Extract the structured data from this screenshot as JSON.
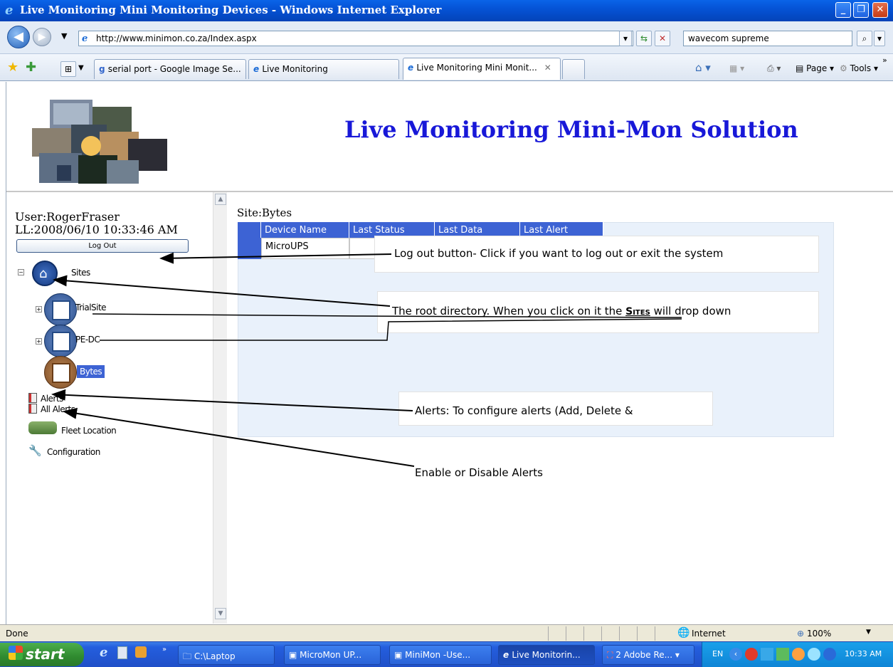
{
  "window": {
    "title": "Live Monitoring Mini Monitoring Devices - Windows Internet Explorer"
  },
  "browser": {
    "url": "http://www.minimon.co.za/Index.aspx",
    "search_value": "wavecom supreme",
    "tabs": [
      {
        "label": "serial port - Google Image Se..."
      },
      {
        "label": "Live Monitoring"
      },
      {
        "label": "Live Monitoring Mini Monit..."
      }
    ],
    "page_menu": "Page",
    "tools_menu": "Tools"
  },
  "header": {
    "title": "Live Monitoring Mini-Mon Solution"
  },
  "sidebar": {
    "user": "User:RogerFraser",
    "last_login": "LL:2008/06/10 10:33:46 AM",
    "logout_label": "Log Out",
    "tree": {
      "root": "Sites",
      "sites": [
        "TrialSite",
        "PE-DC",
        "Bytes"
      ]
    },
    "menu": [
      "Alerts",
      "All Alerts",
      "Fleet Location",
      "Configuration"
    ]
  },
  "main": {
    "site_label": "Site:Bytes",
    "columns": [
      "Device Name",
      "Last Status",
      "Last Data",
      "Last Alert"
    ],
    "rows": [
      [
        "MicroUPS"
      ]
    ]
  },
  "annotations": {
    "logout": "Log out button- Click if you want to log out or exit the system",
    "root_pre": "The root directory. When you click on it the ",
    "root_bold": "Sites",
    "root_post": " will drop down",
    "alerts": "Alerts: To configure alerts (Add, Delete &",
    "all_alerts": "Enable or Disable Alerts"
  },
  "statusbar": {
    "left": "Done",
    "zone": "Internet",
    "zoom": "100%"
  },
  "taskbar": {
    "start": "start",
    "items": [
      "C:\\Laptop",
      "MicroMon UP...",
      "MiniMon -Use...",
      "Live Monitorin...",
      "2 Adobe Re..."
    ],
    "lang": "EN",
    "clock": "10:33 AM"
  }
}
